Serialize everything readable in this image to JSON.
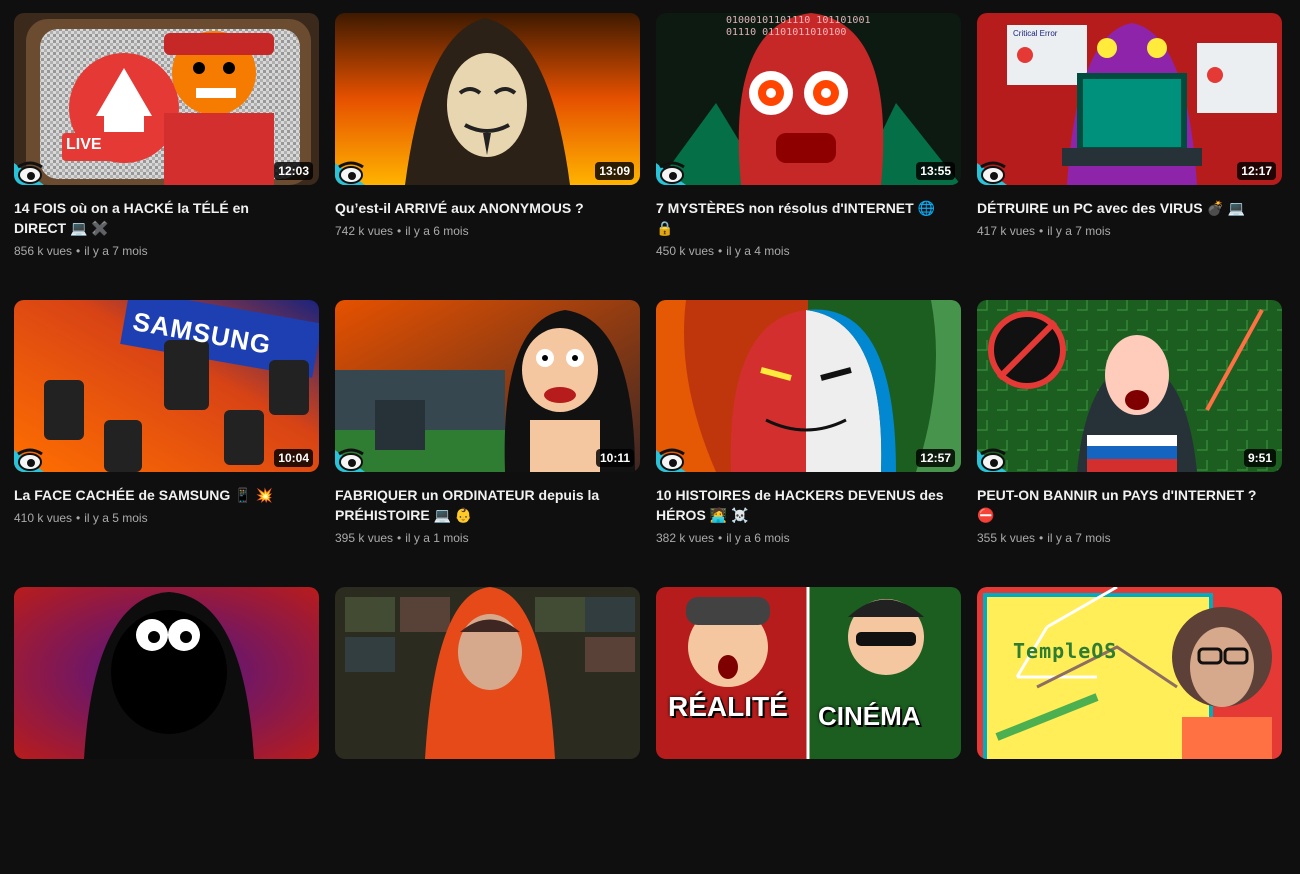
{
  "videos": [
    {
      "title": "14 FOIS où on a HACKÉ la TÉLÉ en DIRECT 💻 ✖️",
      "views": "856 k vues",
      "age": "il y a 7 mois",
      "duration": "12:03",
      "thumb_text": "LIVE"
    },
    {
      "title": "Qu’est-il ARRIVÉ aux ANONYMOUS ?",
      "views": "742 k vues",
      "age": "il y a 6 mois",
      "duration": "13:09"
    },
    {
      "title": "7 MYSTÈRES non résolus d'INTERNET 🌐 🔒",
      "views": "450 k vues",
      "age": "il y a 4 mois",
      "duration": "13:55",
      "thumb_text": "01000101101110 10110100101110 01101011010100"
    },
    {
      "title": "DÉTRUIRE un PC avec des VIRUS 💣 💻",
      "views": "417 k vues",
      "age": "il y a 7 mois",
      "duration": "12:17",
      "thumb_text": "Critical Error"
    },
    {
      "title": "La FACE CACHÉE de SAMSUNG 📱 💥",
      "views": "410 k vues",
      "age": "il y a 5 mois",
      "duration": "10:04",
      "thumb_text": "SAMSUNG"
    },
    {
      "title": "FABRIQUER un ORDINATEUR depuis la PRÉHISTOIRE 💻 👶",
      "views": "395 k vues",
      "age": "il y a 1 mois",
      "duration": "10:11"
    },
    {
      "title": "10 HISTOIRES de HACKERS DEVENUS des HÉROS 🧑‍💻 ☠️",
      "views": "382 k vues",
      "age": "il y a 6 mois",
      "duration": "12:57"
    },
    {
      "title": "PEUT-ON BANNIR un PAYS d'INTERNET ? ⛔",
      "views": "355 k vues",
      "age": "il y a 7 mois",
      "duration": "9:51"
    },
    {
      "title": "",
      "views": "",
      "age": "",
      "duration": ""
    },
    {
      "title": "",
      "views": "",
      "age": "",
      "duration": ""
    },
    {
      "title": "",
      "views": "",
      "age": "",
      "duration": "",
      "thumb_text_1": "RÉALITÉ",
      "thumb_text_2": "CINÉMA"
    },
    {
      "title": "",
      "views": "",
      "age": "",
      "duration": "",
      "thumb_text": "TempleOS"
    }
  ],
  "meta_separator": "•",
  "colors": {
    "background": "#0f0f0f",
    "meta_text": "#aaaaaa",
    "title_text": "#f1f1f1",
    "badge_cyan": "#29c4d9"
  }
}
